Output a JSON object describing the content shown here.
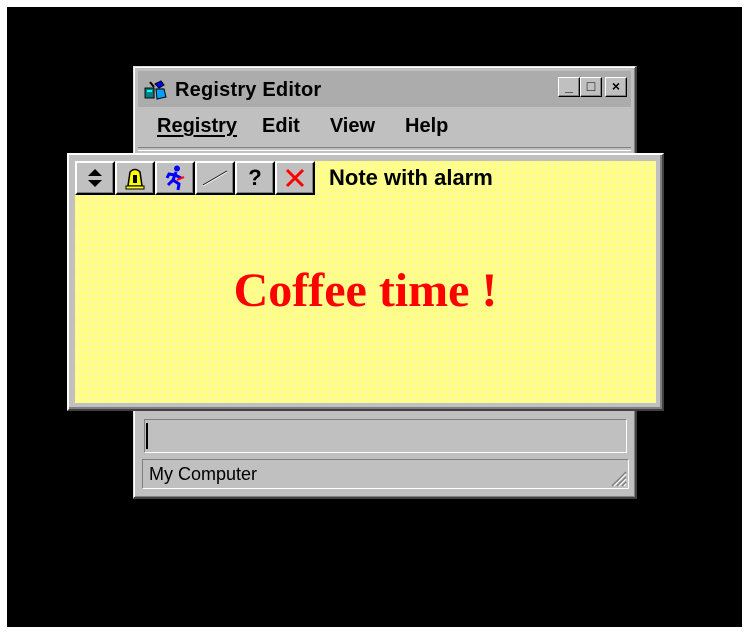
{
  "registry_editor": {
    "title": "Registry Editor",
    "window_buttons": {
      "minimize": "_",
      "maximize": "□",
      "close": "×"
    },
    "menu": [
      {
        "label": "Registry"
      },
      {
        "label": "Edit"
      },
      {
        "label": "View"
      },
      {
        "label": "Help"
      }
    ],
    "status": "My Computer"
  },
  "note": {
    "title": "Note with alarm",
    "message": "Coffee time !",
    "toolbar": {
      "help_glyph": "?"
    },
    "colors": {
      "background": "#ffff80",
      "message": "#ff0000"
    }
  },
  "icons": [
    "registry-editor-icon",
    "updown-arrows-icon",
    "alarm-bell-icon",
    "running-man-icon",
    "line-icon",
    "help-icon",
    "close-x-icon",
    "resize-grip-icon"
  ]
}
